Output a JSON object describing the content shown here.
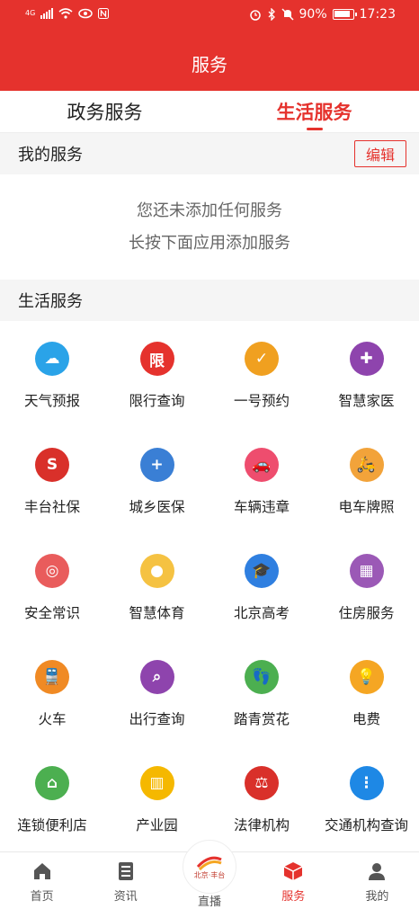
{
  "status_bar": {
    "signal": "4G",
    "battery": "90%",
    "time": "17:23"
  },
  "header": {
    "title": "服务"
  },
  "tabs": [
    {
      "label": "政务服务",
      "active": false
    },
    {
      "label": "生活服务",
      "active": true
    }
  ],
  "my_services": {
    "title": "我的服务",
    "edit_label": "编辑",
    "empty_line1": "您还未添加任何服务",
    "empty_line2": "长按下面应用添加服务"
  },
  "life_services": {
    "title": "生活服务",
    "items": [
      {
        "label": "天气预报",
        "icon": "cloud-icon",
        "color": "#2aa3e8"
      },
      {
        "label": "限行查询",
        "icon": "calendar-limit-icon",
        "color": "#e5322d"
      },
      {
        "label": "一号预约",
        "icon": "calendar-check-icon",
        "color": "#f0a020"
      },
      {
        "label": "智慧家医",
        "icon": "doctor-icon",
        "color": "#8e44ad"
      },
      {
        "label": "丰台社保",
        "icon": "social-security-icon",
        "color": "#d9302a"
      },
      {
        "label": "城乡医保",
        "icon": "medical-kit-icon",
        "color": "#3a7fd5"
      },
      {
        "label": "车辆违章",
        "icon": "car-icon",
        "color": "#ee4d6e"
      },
      {
        "label": "电车牌照",
        "icon": "scooter-icon",
        "color": "#f2a33a"
      },
      {
        "label": "安全常识",
        "icon": "steering-wheel-icon",
        "color": "#e95c5c"
      },
      {
        "label": "智慧体育",
        "icon": "basketball-icon",
        "color": "#f5c242"
      },
      {
        "label": "北京高考",
        "icon": "graduation-cap-icon",
        "color": "#2f7fe0"
      },
      {
        "label": "住房服务",
        "icon": "building-icon",
        "color": "#9b59b6"
      },
      {
        "label": "火车",
        "icon": "train-icon",
        "color": "#f08a24"
      },
      {
        "label": "出行查询",
        "icon": "search-icon",
        "color": "#8e44ad"
      },
      {
        "label": "踏青赏花",
        "icon": "footprint-icon",
        "color": "#4caf50"
      },
      {
        "label": "电费",
        "icon": "lightbulb-icon",
        "color": "#f5a623"
      },
      {
        "label": "连锁便利店",
        "icon": "store-icon",
        "color": "#4caf50"
      },
      {
        "label": "产业园",
        "icon": "industrial-park-icon",
        "color": "#f5b800"
      },
      {
        "label": "法律机构",
        "icon": "scales-icon",
        "color": "#d9302a"
      },
      {
        "label": "交通机构查询",
        "icon": "traffic-light-icon",
        "color": "#1e88e5"
      }
    ]
  },
  "bottom_nav": [
    {
      "label": "首页",
      "icon": "home-icon"
    },
    {
      "label": "资讯",
      "icon": "news-icon"
    },
    {
      "label": "直播",
      "icon": "live-logo-icon",
      "logo_text": "北京·丰台"
    },
    {
      "label": "服务",
      "icon": "service-box-icon",
      "active": true
    },
    {
      "label": "我的",
      "icon": "person-icon"
    }
  ]
}
